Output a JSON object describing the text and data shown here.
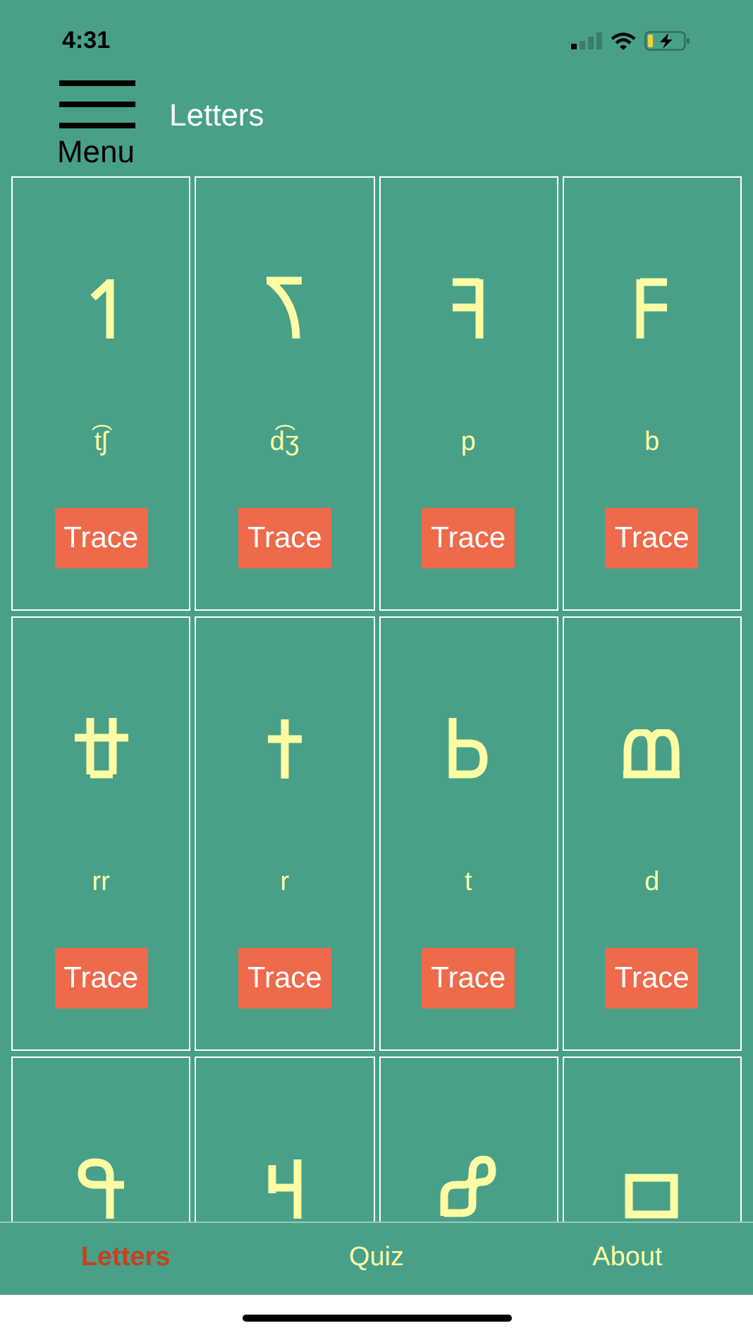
{
  "status_bar": {
    "time": "4:31"
  },
  "header": {
    "menu_label": "Menu",
    "title": "Letters"
  },
  "letters": [
    {
      "kind": "cs",
      "sound": "t͡ʃ",
      "button": "Trace"
    },
    {
      "kind": "dzs",
      "sound": "d͡ʒ",
      "button": "Trace"
    },
    {
      "kind": "p",
      "sound": "p",
      "button": "Trace"
    },
    {
      "kind": "b",
      "sound": "b",
      "button": "Trace"
    },
    {
      "kind": "rr",
      "sound": "rr",
      "button": "Trace"
    },
    {
      "kind": "r",
      "sound": "r",
      "button": "Trace"
    },
    {
      "kind": "t",
      "sound": "t",
      "button": "Trace"
    },
    {
      "kind": "d",
      "sound": "d",
      "button": "Trace"
    },
    {
      "kind": "q"
    },
    {
      "kind": "hook"
    },
    {
      "kind": "loop"
    },
    {
      "kind": "square"
    }
  ],
  "tabs": [
    {
      "label": "Letters",
      "selected": true
    },
    {
      "label": "Quiz",
      "selected": false
    },
    {
      "label": "About",
      "selected": false
    }
  ]
}
